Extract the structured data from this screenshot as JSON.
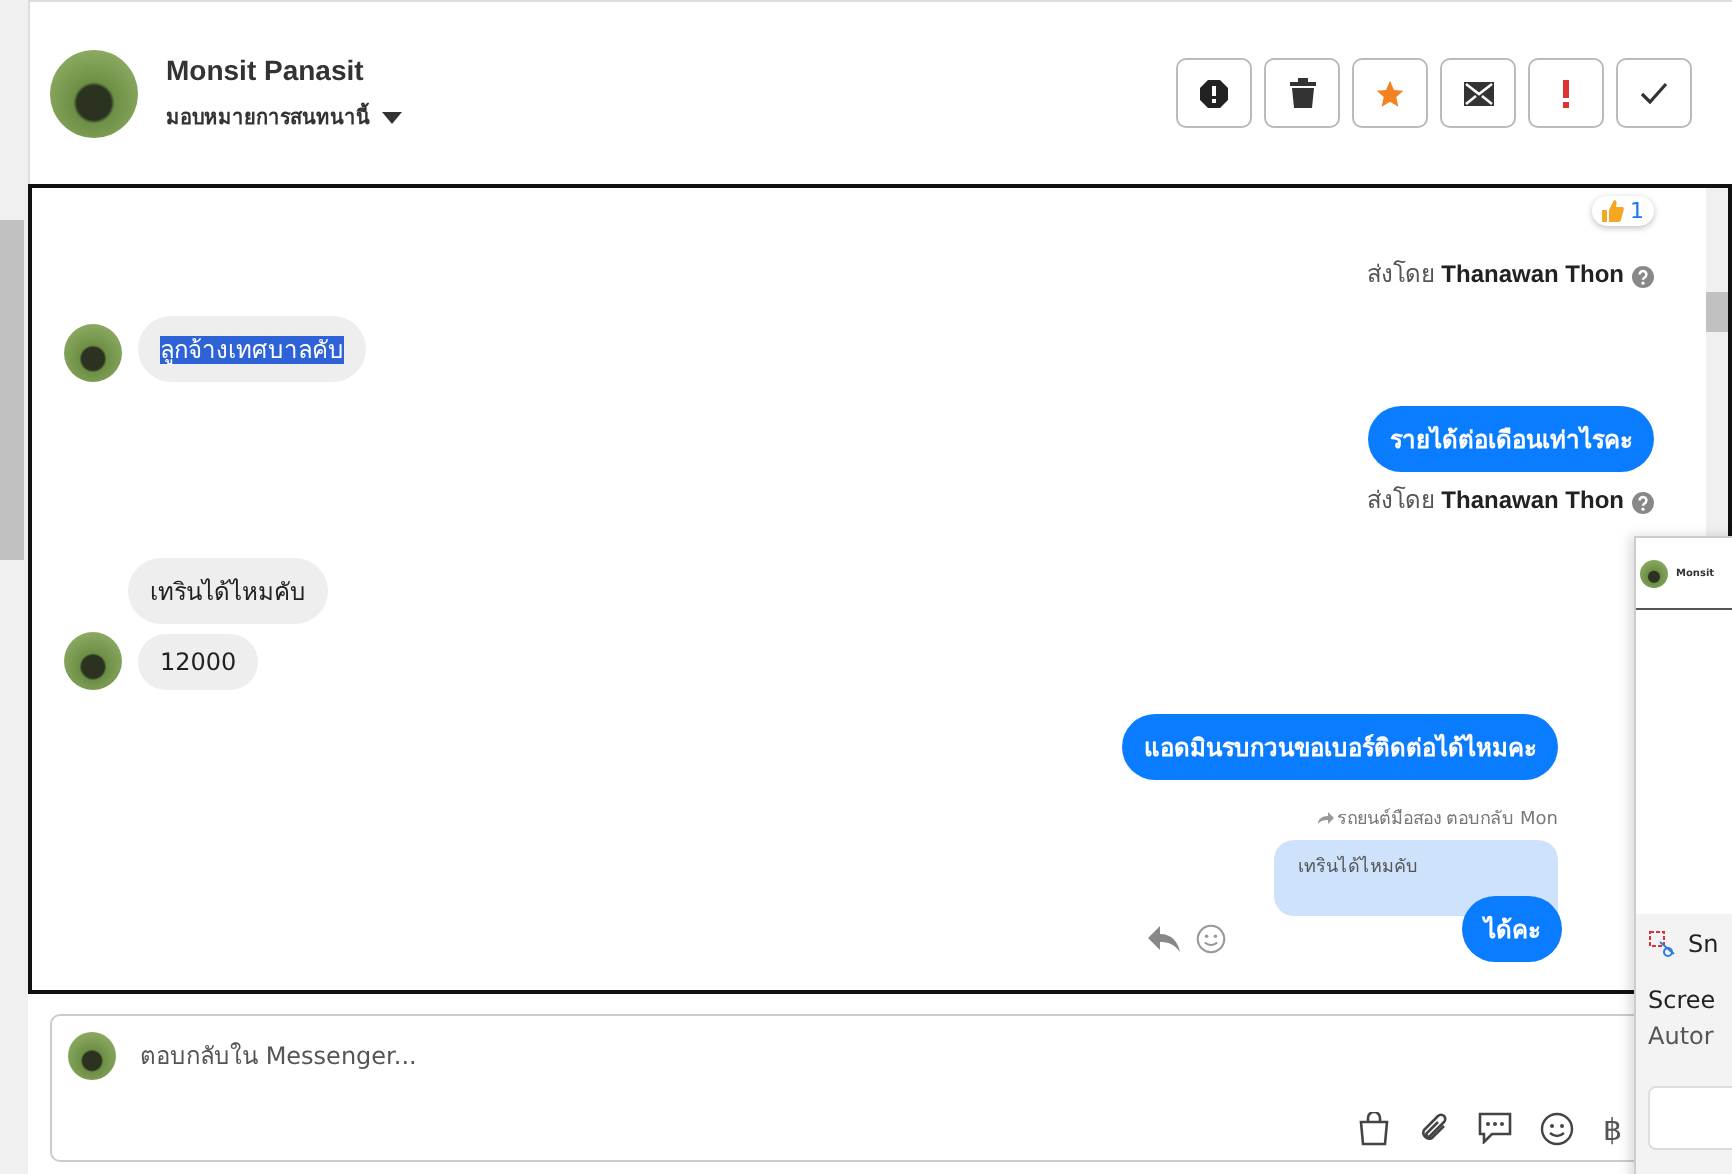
{
  "header": {
    "name": "Monsit Panasit",
    "assign_label": "มอบหมายการสนทนานี้",
    "actions": [
      {
        "kind": "alert"
      },
      {
        "kind": "trash"
      },
      {
        "kind": "star"
      },
      {
        "kind": "mail"
      },
      {
        "kind": "exclamation"
      },
      {
        "kind": "check"
      }
    ]
  },
  "messages": [
    {
      "kind": "reaction",
      "count": "1"
    },
    {
      "kind": "sent_by",
      "prefix": "ส่งโดย",
      "name": "Thanawan Thon"
    },
    {
      "kind": "incoming",
      "text": "ลูกจ้างเทศบาลคับ",
      "avatar": true,
      "selected": true
    },
    {
      "kind": "outgoing",
      "text": "รายได้ต่อเดือนเท่าไรคะ"
    },
    {
      "kind": "sent_by",
      "prefix": "ส่งโดย",
      "name": "Thanawan Thon"
    },
    {
      "kind": "incoming",
      "text": "เทรินได้ไหมคับ",
      "avatar": false,
      "selected": false
    },
    {
      "kind": "incoming",
      "text": "12000",
      "avatar": true,
      "selected": false
    },
    {
      "kind": "outgoing",
      "text": "แอดมินรบกวนขอเบอร์ติดต่อได้ไหมคะ"
    },
    {
      "kind": "reply_context",
      "text": "รถยนต์มือสอง ตอบกลับ Mon"
    },
    {
      "kind": "quoted",
      "text": "เทรินได้ไหมคับ"
    },
    {
      "kind": "outgoing_actions",
      "text": "ได้คะ"
    }
  ],
  "composer": {
    "placeholder": "ตอบกลับใน Messenger...",
    "tools": [
      {
        "kind": "bag"
      },
      {
        "kind": "paperclip"
      },
      {
        "kind": "chat"
      },
      {
        "kind": "smile"
      },
      {
        "kind": "text",
        "label": "฿"
      }
    ]
  },
  "overlay": {
    "title": "Monsit",
    "app": "Sn",
    "line_1": "Scree",
    "line_2": "Autor"
  }
}
